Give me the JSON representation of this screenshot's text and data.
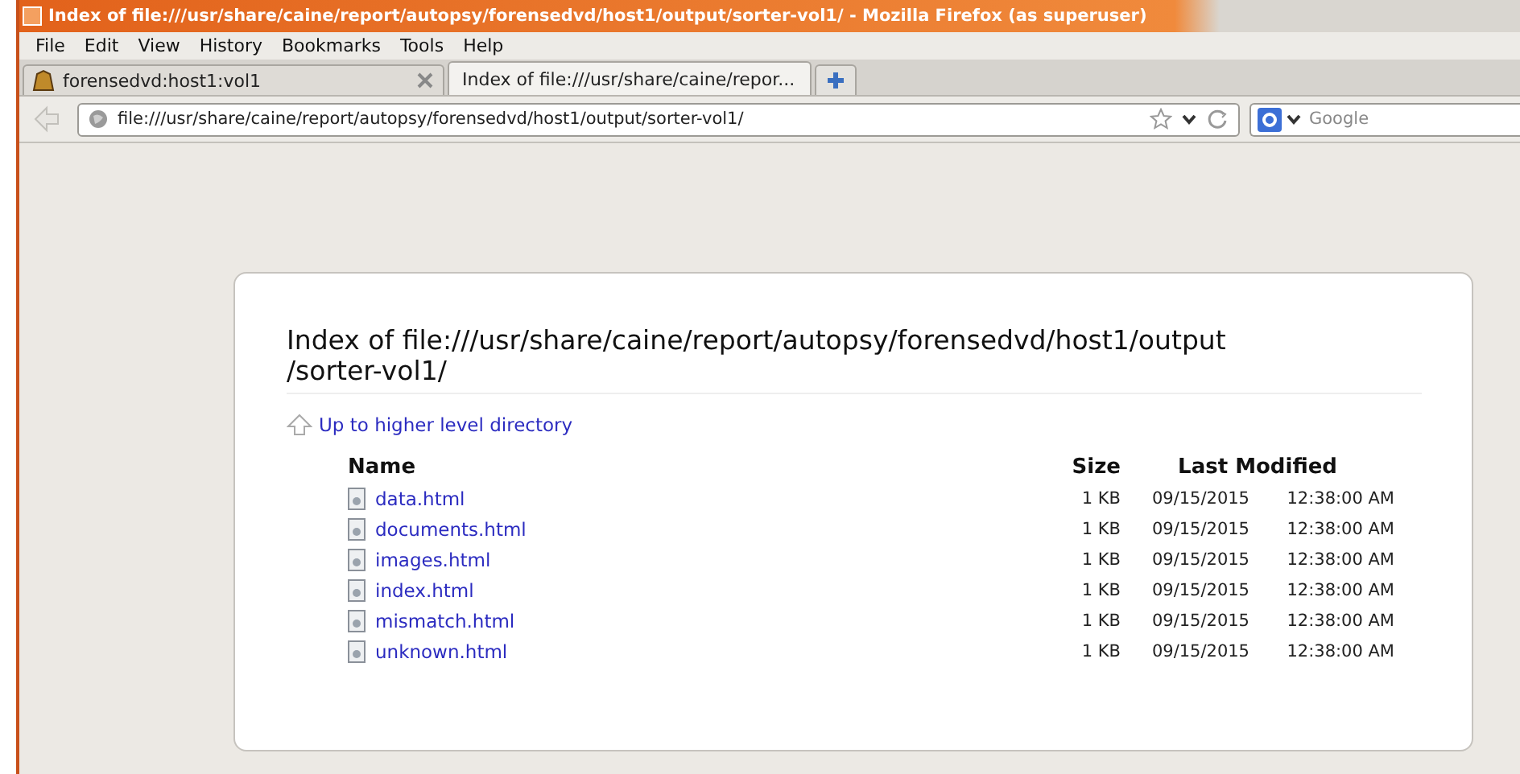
{
  "window": {
    "title": "Index of file:///usr/share/caine/report/autopsy/forensedvd/host1/output/sorter-vol1/ - Mozilla Firefox (as superuser)"
  },
  "menu": [
    "File",
    "Edit",
    "View",
    "History",
    "Bookmarks",
    "Tools",
    "Help"
  ],
  "tabs": [
    {
      "label": "forensedvd:host1:vol1",
      "selected": false
    },
    {
      "label": "Index of file:///usr/share/caine/repor...",
      "selected": true
    }
  ],
  "address_bar": {
    "value": "file:///usr/share/caine/report/autopsy/forensedvd/host1/output/sorter-vol1/"
  },
  "search": {
    "placeholder": "Google"
  },
  "page": {
    "heading": "Index of file:///usr/share/caine/report/autopsy/forensedvd/host1/output /sorter-vol1/",
    "up_link": "Up to higher level directory",
    "columns": [
      "Name",
      "Size",
      "Last Modified"
    ],
    "rows": [
      {
        "name": "data.html",
        "size": "1 KB",
        "date": "09/15/2015",
        "time": "12:38:00 AM"
      },
      {
        "name": "documents.html",
        "size": "1 KB",
        "date": "09/15/2015",
        "time": "12:38:00 AM"
      },
      {
        "name": "images.html",
        "size": "1 KB",
        "date": "09/15/2015",
        "time": "12:38:00 AM"
      },
      {
        "name": "index.html",
        "size": "1 KB",
        "date": "09/15/2015",
        "time": "12:38:00 AM"
      },
      {
        "name": "mismatch.html",
        "size": "1 KB",
        "date": "09/15/2015",
        "time": "12:38:00 AM"
      },
      {
        "name": "unknown.html",
        "size": "1 KB",
        "date": "09/15/2015",
        "time": "12:38:00 AM"
      }
    ]
  }
}
